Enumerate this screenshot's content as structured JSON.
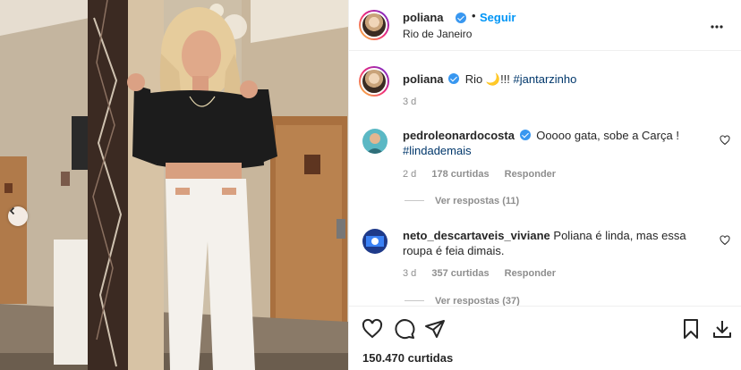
{
  "post": {
    "username": "poliana",
    "follow_label": "Seguir",
    "dot": "•",
    "location": "Rio de Janeiro",
    "more_label": "•••"
  },
  "caption": {
    "username": "poliana",
    "text": "Rio 🌙!!! ",
    "hashtag": "#jantarzinho",
    "time": "3 d"
  },
  "comments": [
    {
      "username": "pedroleonardocosta",
      "verified": true,
      "text": "Ooooo gata, sobe a Carça !",
      "hashtag": "#lindademais",
      "time": "2 d",
      "likes": "178 curtidas",
      "reply_label": "Responder",
      "view_replies": "Ver respostas (11)"
    },
    {
      "username": "neto_descartaveis_viviane",
      "verified": false,
      "text": "Poliana é linda, mas essa roupa é feia dimais.",
      "time": "3 d",
      "likes": "357 curtidas",
      "reply_label": "Responder",
      "view_replies": "Ver respostas (37)"
    }
  ],
  "actions": {
    "likes_count": "150.470 curtidas"
  },
  "icons": {
    "more": "more-options-icon",
    "heart": "heart-icon",
    "comment": "comment-icon",
    "share": "share-icon",
    "save": "bookmark-icon",
    "download": "download-icon",
    "prev": "chevron-left-icon"
  },
  "colors": {
    "link_blue": "#0095f6",
    "hashtag": "#00376b",
    "muted": "#8e8e8e",
    "verified": "#3897f0"
  }
}
